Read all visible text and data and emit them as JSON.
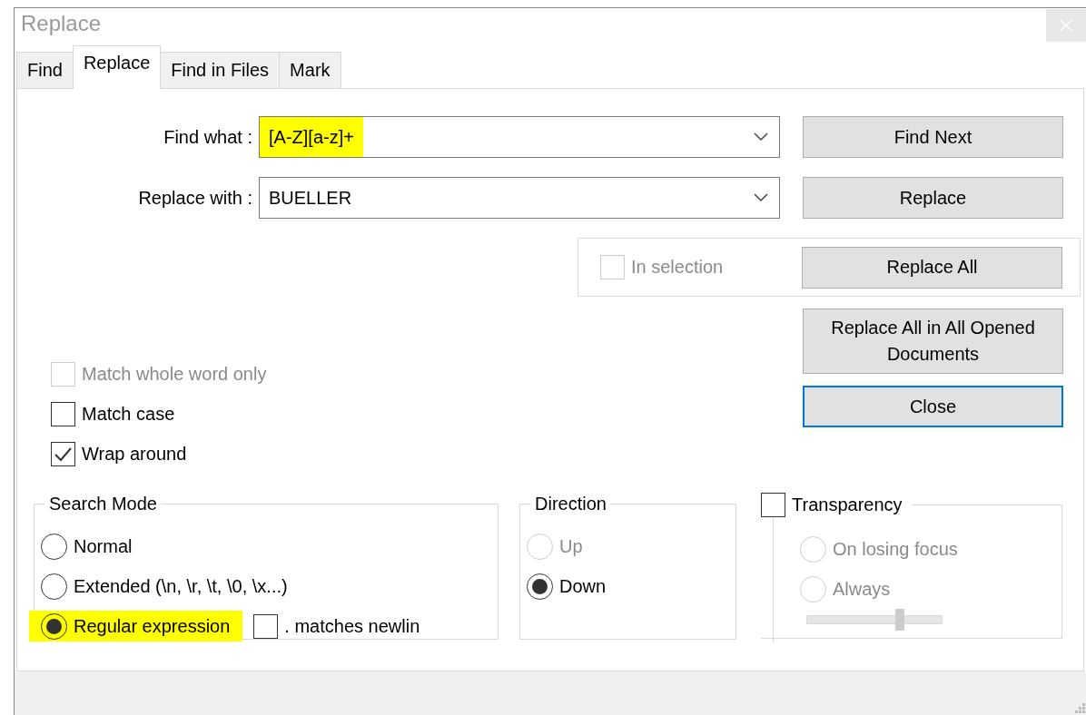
{
  "window": {
    "title": "Replace"
  },
  "tabs": [
    {
      "label": "Find",
      "selected": false
    },
    {
      "label": "Replace",
      "selected": true
    },
    {
      "label": "Find in Files",
      "selected": false
    },
    {
      "label": "Mark",
      "selected": false
    }
  ],
  "find_what": {
    "label": "Find what :",
    "value": "[A-Z][a-z]+",
    "highlighted": true
  },
  "replace_with": {
    "label": "Replace with :",
    "value": "BUELLER",
    "highlighted": false
  },
  "in_selection": {
    "label": "In selection",
    "checked": false,
    "disabled": true
  },
  "buttons": [
    {
      "label": "Find Next",
      "focused": false
    },
    {
      "label": "Replace",
      "focused": false
    },
    {
      "label": "Replace All",
      "focused": false
    },
    {
      "label": "Replace All in All Opened Documents",
      "focused": false
    },
    {
      "label": "Close",
      "focused": true
    }
  ],
  "options": [
    {
      "label": "Match whole word only",
      "checked": false,
      "disabled": true
    },
    {
      "label": "Match case",
      "checked": false,
      "disabled": false
    },
    {
      "label": "Wrap around",
      "checked": true,
      "disabled": false
    }
  ],
  "search_mode": {
    "title": "Search Mode",
    "options": [
      {
        "label": "Normal",
        "selected": false,
        "highlighted": false
      },
      {
        "label": "Extended (\\n, \\r, \\t, \\0, \\x...)",
        "selected": false,
        "highlighted": false
      },
      {
        "label": "Regular expression",
        "selected": true,
        "highlighted": true
      }
    ],
    "matches_newline": {
      "label": ". matches newlin",
      "checked": false,
      "disabled": false
    }
  },
  "direction": {
    "title": "Direction",
    "options": [
      {
        "label": "Up",
        "selected": false,
        "disabled": true
      },
      {
        "label": "Down",
        "selected": true,
        "disabled": false
      }
    ]
  },
  "transparency": {
    "label": "Transparency",
    "checked": false,
    "options": [
      {
        "label": "On losing focus",
        "selected": false,
        "disabled": true
      },
      {
        "label": "Always",
        "selected": false,
        "disabled": true
      }
    ],
    "slider": {
      "level": 0.69,
      "disabled": true
    }
  }
}
